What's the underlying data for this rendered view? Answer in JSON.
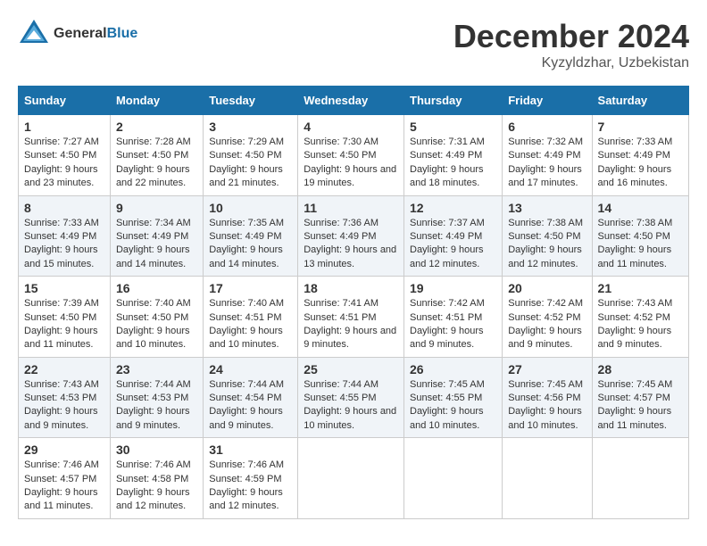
{
  "header": {
    "logo_general": "General",
    "logo_blue": "Blue",
    "month": "December 2024",
    "location": "Kyzyldzhar, Uzbekistan"
  },
  "columns": [
    "Sunday",
    "Monday",
    "Tuesday",
    "Wednesday",
    "Thursday",
    "Friday",
    "Saturday"
  ],
  "weeks": [
    [
      {
        "day": "1",
        "sunrise": "7:27 AM",
        "sunset": "4:50 PM",
        "daylight": "9 hours and 23 minutes."
      },
      {
        "day": "2",
        "sunrise": "7:28 AM",
        "sunset": "4:50 PM",
        "daylight": "9 hours and 22 minutes."
      },
      {
        "day": "3",
        "sunrise": "7:29 AM",
        "sunset": "4:50 PM",
        "daylight": "9 hours and 21 minutes."
      },
      {
        "day": "4",
        "sunrise": "7:30 AM",
        "sunset": "4:50 PM",
        "daylight": "9 hours and 19 minutes."
      },
      {
        "day": "5",
        "sunrise": "7:31 AM",
        "sunset": "4:49 PM",
        "daylight": "9 hours and 18 minutes."
      },
      {
        "day": "6",
        "sunrise": "7:32 AM",
        "sunset": "4:49 PM",
        "daylight": "9 hours and 17 minutes."
      },
      {
        "day": "7",
        "sunrise": "7:33 AM",
        "sunset": "4:49 PM",
        "daylight": "9 hours and 16 minutes."
      }
    ],
    [
      {
        "day": "8",
        "sunrise": "7:33 AM",
        "sunset": "4:49 PM",
        "daylight": "9 hours and 15 minutes."
      },
      {
        "day": "9",
        "sunrise": "7:34 AM",
        "sunset": "4:49 PM",
        "daylight": "9 hours and 14 minutes."
      },
      {
        "day": "10",
        "sunrise": "7:35 AM",
        "sunset": "4:49 PM",
        "daylight": "9 hours and 14 minutes."
      },
      {
        "day": "11",
        "sunrise": "7:36 AM",
        "sunset": "4:49 PM",
        "daylight": "9 hours and 13 minutes."
      },
      {
        "day": "12",
        "sunrise": "7:37 AM",
        "sunset": "4:49 PM",
        "daylight": "9 hours and 12 minutes."
      },
      {
        "day": "13",
        "sunrise": "7:38 AM",
        "sunset": "4:50 PM",
        "daylight": "9 hours and 12 minutes."
      },
      {
        "day": "14",
        "sunrise": "7:38 AM",
        "sunset": "4:50 PM",
        "daylight": "9 hours and 11 minutes."
      }
    ],
    [
      {
        "day": "15",
        "sunrise": "7:39 AM",
        "sunset": "4:50 PM",
        "daylight": "9 hours and 11 minutes."
      },
      {
        "day": "16",
        "sunrise": "7:40 AM",
        "sunset": "4:50 PM",
        "daylight": "9 hours and 10 minutes."
      },
      {
        "day": "17",
        "sunrise": "7:40 AM",
        "sunset": "4:51 PM",
        "daylight": "9 hours and 10 minutes."
      },
      {
        "day": "18",
        "sunrise": "7:41 AM",
        "sunset": "4:51 PM",
        "daylight": "9 hours and 9 minutes."
      },
      {
        "day": "19",
        "sunrise": "7:42 AM",
        "sunset": "4:51 PM",
        "daylight": "9 hours and 9 minutes."
      },
      {
        "day": "20",
        "sunrise": "7:42 AM",
        "sunset": "4:52 PM",
        "daylight": "9 hours and 9 minutes."
      },
      {
        "day": "21",
        "sunrise": "7:43 AM",
        "sunset": "4:52 PM",
        "daylight": "9 hours and 9 minutes."
      }
    ],
    [
      {
        "day": "22",
        "sunrise": "7:43 AM",
        "sunset": "4:53 PM",
        "daylight": "9 hours and 9 minutes."
      },
      {
        "day": "23",
        "sunrise": "7:44 AM",
        "sunset": "4:53 PM",
        "daylight": "9 hours and 9 minutes."
      },
      {
        "day": "24",
        "sunrise": "7:44 AM",
        "sunset": "4:54 PM",
        "daylight": "9 hours and 9 minutes."
      },
      {
        "day": "25",
        "sunrise": "7:44 AM",
        "sunset": "4:55 PM",
        "daylight": "9 hours and 10 minutes."
      },
      {
        "day": "26",
        "sunrise": "7:45 AM",
        "sunset": "4:55 PM",
        "daylight": "9 hours and 10 minutes."
      },
      {
        "day": "27",
        "sunrise": "7:45 AM",
        "sunset": "4:56 PM",
        "daylight": "9 hours and 10 minutes."
      },
      {
        "day": "28",
        "sunrise": "7:45 AM",
        "sunset": "4:57 PM",
        "daylight": "9 hours and 11 minutes."
      }
    ],
    [
      {
        "day": "29",
        "sunrise": "7:46 AM",
        "sunset": "4:57 PM",
        "daylight": "9 hours and 11 minutes."
      },
      {
        "day": "30",
        "sunrise": "7:46 AM",
        "sunset": "4:58 PM",
        "daylight": "9 hours and 12 minutes."
      },
      {
        "day": "31",
        "sunrise": "7:46 AM",
        "sunset": "4:59 PM",
        "daylight": "9 hours and 12 minutes."
      },
      null,
      null,
      null,
      null
    ]
  ]
}
